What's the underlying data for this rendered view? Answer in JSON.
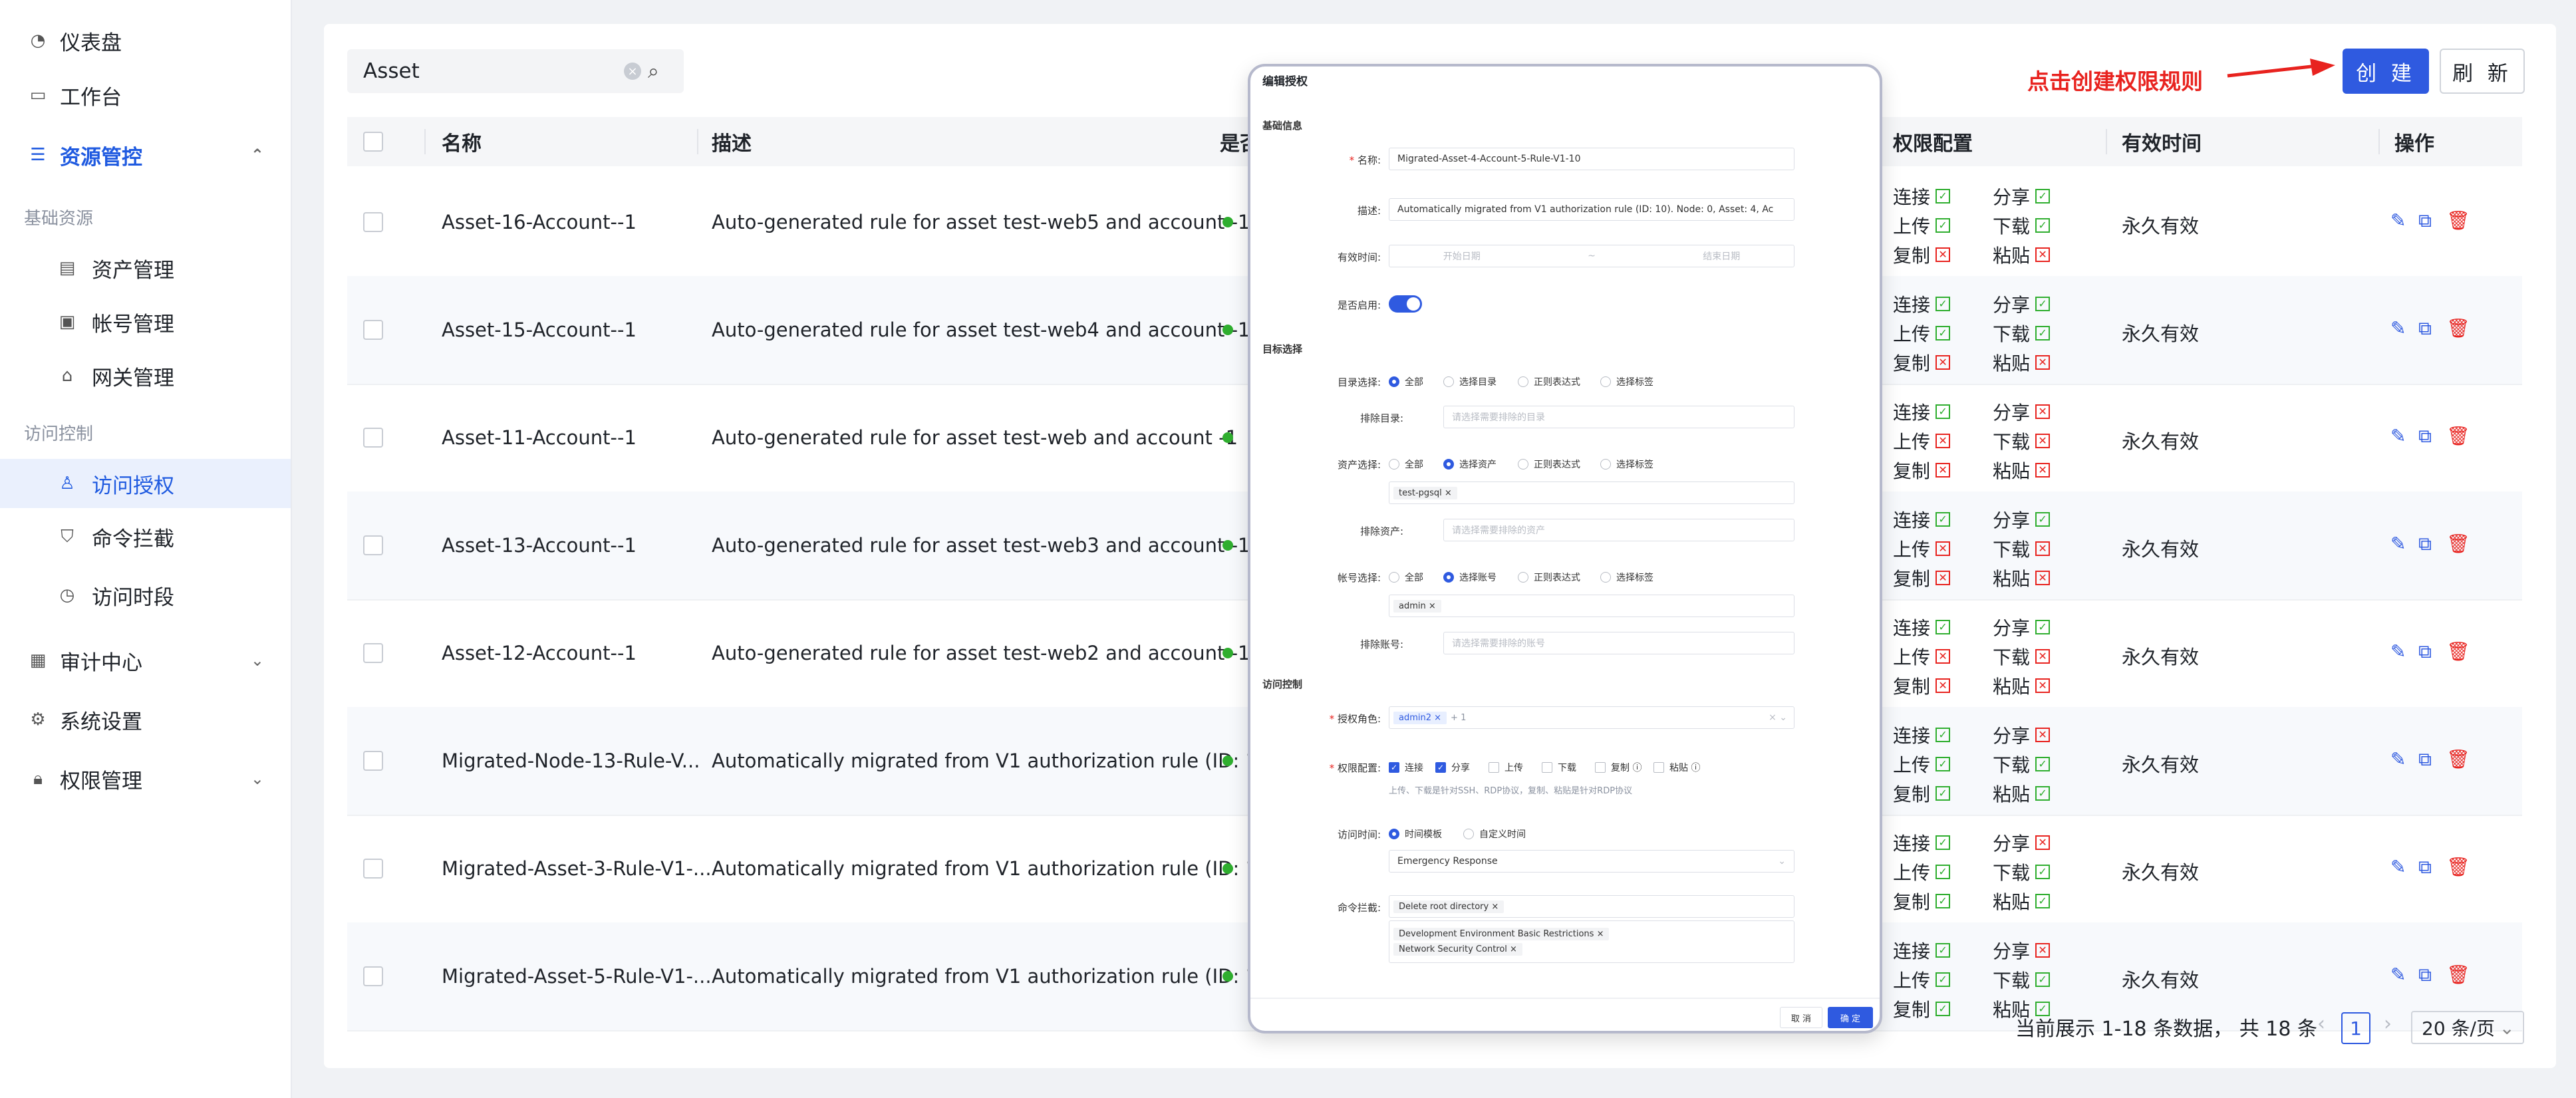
{
  "sidebar": {
    "dashboard": "仪表盘",
    "workbench": "工作台",
    "resource_control": "资源管控",
    "group_basic": "基础资源",
    "asset_mgmt": "资产管理",
    "account_mgmt": "帐号管理",
    "gateway_mgmt": "网关管理",
    "group_access": "访问控制",
    "access_auth": "访问授权",
    "command_block": "命令拦截",
    "access_period": "访问时段",
    "audit_center": "审计中心",
    "system_settings": "系统设置",
    "permission_mgmt": "权限管理"
  },
  "toolbar": {
    "search_value": "Asset",
    "create_label": "创 建",
    "refresh_label": "刷 新",
    "annotation": "点击创建权限规则"
  },
  "table": {
    "headers": {
      "name": "名称",
      "desc": "描述",
      "enabled": "是否",
      "perm": "权限配置",
      "valid": "有效时间",
      "ops": "操作"
    },
    "perm_labels": {
      "connect": "连接",
      "share": "分享",
      "upload": "上传",
      "download": "下载",
      "copy": "复制",
      "paste": "粘贴"
    },
    "rows": [
      {
        "name": "Asset-16-Account--1",
        "desc": "Auto-generated rule for asset test-web5 and account -1",
        "valid": "永久有效"
      },
      {
        "name": "Asset-15-Account--1",
        "desc": "Auto-generated rule for asset test-web4 and account -1",
        "valid": "永久有效"
      },
      {
        "name": "Asset-11-Account--1",
        "desc": "Auto-generated rule for asset test-web and account -1",
        "valid": "永久有效"
      },
      {
        "name": "Asset-13-Account--1",
        "desc": "Auto-generated rule for asset test-web3 and account -1",
        "valid": "永久有效"
      },
      {
        "name": "Asset-12-Account--1",
        "desc": "Auto-generated rule for asset test-web2 and account -1",
        "valid": "永久有效"
      },
      {
        "name": "Migrated-Node-13-Rule-V...",
        "desc": "Automatically migrated from V1 authorization rule (ID: 1...",
        "valid": "永久有效"
      },
      {
        "name": "Migrated-Asset-3-Rule-V1-...",
        "desc": "Automatically migrated from V1 authorization rule (ID: 1...",
        "valid": "永久有效"
      },
      {
        "name": "Migrated-Asset-5-Rule-V1-...",
        "desc": "Automatically migrated from V1 authorization rule (ID: 1...",
        "valid": "永久有效"
      }
    ]
  },
  "pagination": {
    "summary": "当前展示 1-18 条数据， 共 18 条",
    "page": "1",
    "page_size": "20 条/页"
  },
  "modal": {
    "title": "编辑授权",
    "sec_basic": "基础信息",
    "name_label": "名称:",
    "name_value": "Migrated-Asset-4-Account-5-Rule-V1-10",
    "desc_label": "描述:",
    "desc_value": "Automatically migrated from V1 authorization rule (ID: 10). Node: 0, Asset: 4, Ac",
    "valid_label": "有效时间:",
    "start_ph": "开始日期",
    "end_ph": "结束日期",
    "enabled_label": "是否启用:",
    "sec_target": "目标选择",
    "dir_label": "目录选择:",
    "opt_all": "全部",
    "opt_dir": "选择目录",
    "opt_regex": "正则表达式",
    "opt_tag": "选择标签",
    "exclude_dir_label": "排除目录:",
    "exclude_dir_ph": "请选择需要排除的目录",
    "asset_label": "资产选择:",
    "opt_asset": "选择资产",
    "asset_tag": "test-pgsql",
    "exclude_asset_label": "排除资产:",
    "exclude_asset_ph": "请选择需要排除的资产",
    "account_label": "帐号选择:",
    "opt_account": "选择账号",
    "account_tag": "admin",
    "exclude_account_label": "排除账号:",
    "exclude_account_ph": "请选择需要排除的账号",
    "sec_access": "访问控制",
    "role_label": "授权角色:",
    "role_tag": "admin2",
    "role_more": "+ 1",
    "perm_label": "权限配置:",
    "p_connect": "连接",
    "p_share": "分享",
    "p_upload": "上传",
    "p_download": "下载",
    "p_copy": "复制",
    "p_paste": "粘贴",
    "perm_hint": "上传、下载是针对SSH、RDP协议，复制、粘贴是针对RDP协议",
    "time_label": "访问时间:",
    "opt_template": "时间模板",
    "opt_custom": "自定义时间",
    "template_value": "Emergency Response",
    "cmd_label": "命令拦截:",
    "cmd_tag1": "Delete root directory",
    "cmd_tag2": "Development Environment Basic Restrictions",
    "cmd_tag3": "Network Security Control",
    "cancel": "取 消",
    "ok": "确 定"
  },
  "colors": {
    "primary": "#2f5ae0",
    "annotation": "#e8231f",
    "status_ok": "#2fae2f"
  }
}
